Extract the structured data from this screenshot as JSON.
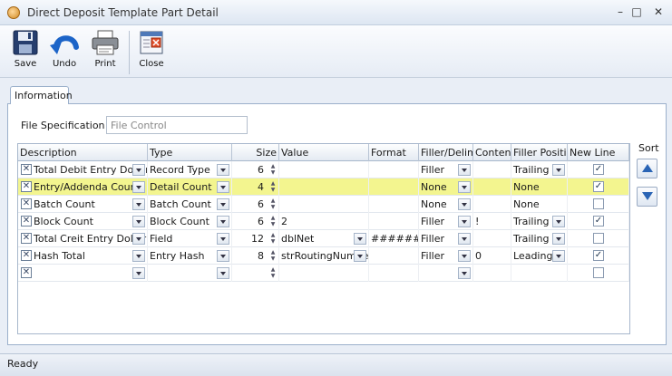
{
  "window": {
    "title": "Direct Deposit Template Part Detail",
    "minimize": "–",
    "maximize": "□",
    "close": "✕"
  },
  "toolbar": {
    "save_label": "Save",
    "undo_label": "Undo",
    "print_label": "Print",
    "close_label": "Close"
  },
  "tabs": [
    {
      "label": "Information"
    }
  ],
  "file_spec": {
    "label": "File Specification",
    "value": "File Control"
  },
  "grid": {
    "columns": [
      "Description",
      "Type",
      "Size",
      "Value",
      "Format",
      "Filler/Delimeter",
      "Content",
      "Filler Position",
      "New Line"
    ],
    "rows": [
      {
        "description": "Total Debit Entry Dollar",
        "type": "Record Type",
        "size": "6",
        "value": "",
        "format": "",
        "filler": "Filler",
        "content": "",
        "position": "Trailing",
        "newline": "✓"
      },
      {
        "description": "Entry/Addenda Count",
        "type": "Detail Count",
        "size": "4",
        "value": "",
        "format": "",
        "filler": "None",
        "content": "",
        "position": "None",
        "newline": "✓"
      },
      {
        "description": "Batch Count",
        "type": "Batch Count",
        "size": "6",
        "value": "",
        "format": "",
        "filler": "None",
        "content": "",
        "position": "None",
        "newline": ""
      },
      {
        "description": "Block Count",
        "type": "Block Count",
        "size": "6",
        "value": "2",
        "format": "",
        "filler": "Filler",
        "content": "!",
        "position": "Trailing",
        "newline": "✓"
      },
      {
        "description": "Total Creit Entry Dollar",
        "type": "Field",
        "size": "12",
        "value": "dblNet",
        "format": "######",
        "filler": "Filler",
        "content": "",
        "position": "Trailing",
        "newline": ""
      },
      {
        "description": "Hash Total",
        "type": "Entry Hash",
        "size": "8",
        "value": "strRoutingNumber",
        "format": "",
        "filler": "Filler",
        "content": "0",
        "position": "Leading",
        "newline": "✓"
      },
      {
        "description": "",
        "type": "",
        "size": "",
        "value": "",
        "format": "",
        "filler": "",
        "content": "",
        "position": "",
        "newline": ""
      }
    ]
  },
  "sort": {
    "label": "Sort"
  },
  "status": {
    "text": "Ready"
  },
  "icons": {
    "remove": "✕",
    "spin_up": "▲",
    "spin_down": "▼"
  },
  "colors": {
    "selected_row": "#f3f58f",
    "accent": "#2a64b5"
  }
}
